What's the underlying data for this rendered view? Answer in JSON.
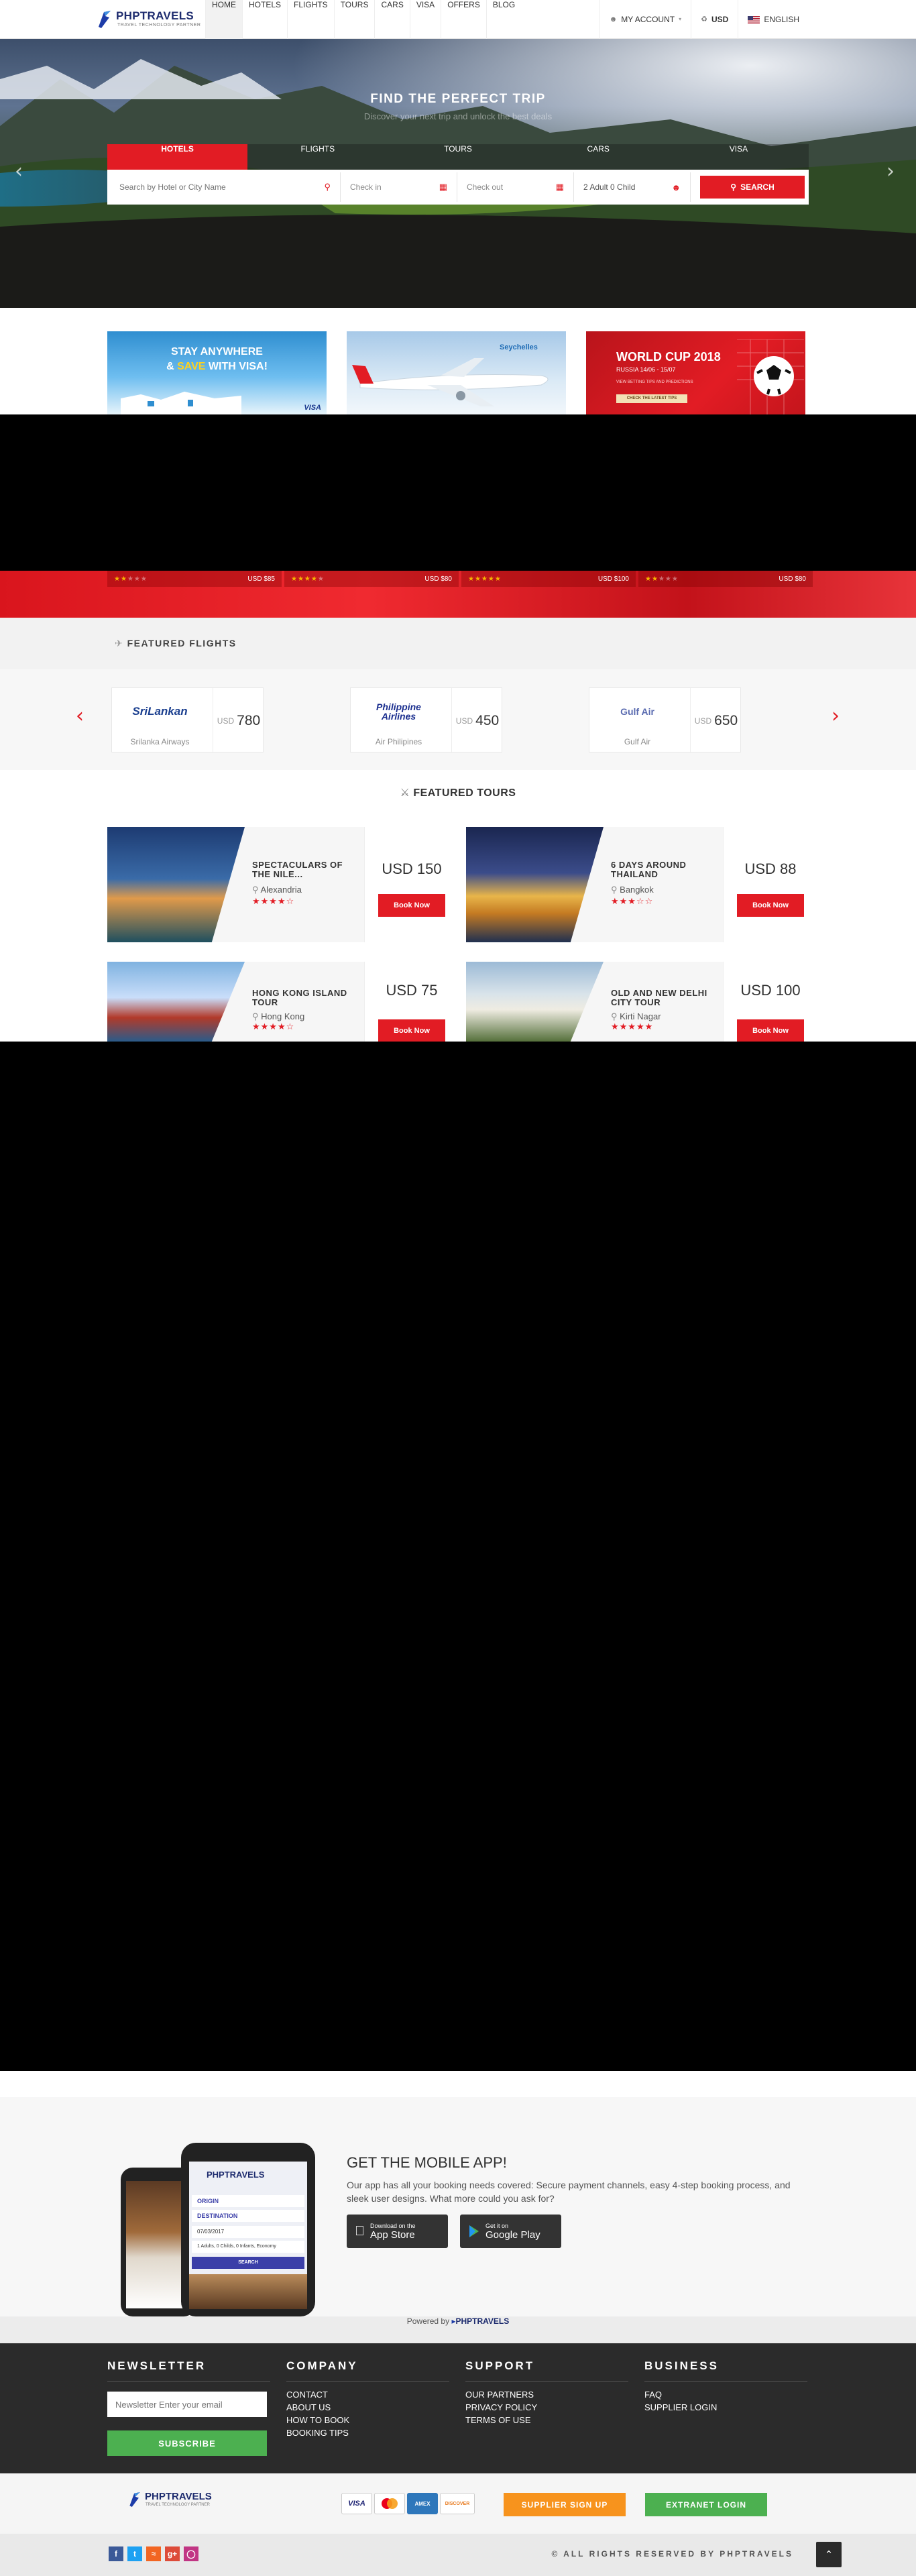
{
  "brand": {
    "name": "PHPTRAVELS",
    "tagline": "TRAVEL TECHNOLOGY PARTNER"
  },
  "nav": {
    "items": [
      "HOME",
      "HOTELS",
      "FLIGHTS",
      "TOURS",
      "CARS",
      "VISA",
      "OFFERS",
      "BLOG"
    ],
    "account": "MY ACCOUNT",
    "currency": "USD",
    "language": "ENGLISH"
  },
  "hero": {
    "title": "FIND THE PERFECT TRIP",
    "subtitle": "Discover your next trip and unlock the best deals",
    "tabs": [
      "HOTELS",
      "FLIGHTS",
      "TOURS",
      "CARS",
      "VISA"
    ],
    "search": {
      "placeholder": "Search by Hotel or City Name",
      "checkin": "Check in",
      "checkout": "Check out",
      "guests": "2 Adult 0 Child",
      "button": "SEARCH"
    }
  },
  "banners": {
    "visa_line1": "STAY ANYWHERE",
    "visa_line2_a": "& ",
    "visa_line2_b": "SAVE",
    "visa_line2_c": " WITH VISA!",
    "visa_brand": "VISA",
    "airline_brand": "Seychelles",
    "worldcup_title": "WORLD CUP 2018",
    "worldcup_dates": "RUSSIA 14/06 - 15/07",
    "worldcup_tagline": "VIEW BETTING TIPS AND PREDICTIONS",
    "worldcup_cta": "CHECK THE LATEST TIPS"
  },
  "strip_cards": [
    {
      "stars": 2,
      "price": "USD $85"
    },
    {
      "stars": 4,
      "price": "USD $80"
    },
    {
      "stars": 5,
      "price": "USD $100"
    },
    {
      "stars": 2,
      "price": "USD $80"
    }
  ],
  "featured_flights": {
    "heading": "FEATURED FLIGHTS",
    "items": [
      {
        "airline": "Srilanka Airways",
        "logo": "SriLankan",
        "currency": "USD",
        "price": "780"
      },
      {
        "airline": "Air Philipines",
        "logo": "Philippine Airlines",
        "currency": "USD",
        "price": "450"
      },
      {
        "airline": "Gulf Air",
        "logo": "Gulf Air",
        "currency": "USD",
        "price": "650"
      }
    ]
  },
  "featured_tours": {
    "heading": "FEATURED TOURS",
    "book_label": "Book Now",
    "items": [
      {
        "name": "SPECTACULARS OF THE NILE...",
        "location": "Alexandria",
        "stars": 4,
        "price": "USD 150"
      },
      {
        "name": "6 DAYS AROUND THAILAND",
        "location": "Bangkok",
        "stars": 3,
        "price": "USD 88"
      },
      {
        "name": "HONG KONG ISLAND TOUR",
        "location": "Hong Kong",
        "stars": 4,
        "price": "USD 75"
      },
      {
        "name": "OLD AND NEW DELHI CITY TOUR",
        "location": "Kirti Nagar",
        "stars": 5,
        "price": "USD 100"
      }
    ]
  },
  "mobile_app": {
    "title": "GET THE MOBILE APP!",
    "text": "Our app has all your booking needs covered: Secure payment channels, easy 4-step booking process, and sleek user designs. What more could you ask for?",
    "appstore_small": "Download on the",
    "appstore_big": "App Store",
    "play_small": "Get it on",
    "play_big": "Google Play",
    "phone": {
      "origin": "ORIGIN",
      "destination": "DESTINATION",
      "date": "07/03/2017",
      "adults": "1 Adults, 0 Childs, 0 Infants, Economy",
      "search": "SEARCH",
      "brand": "PHPTRAVELS"
    }
  },
  "powered": {
    "prefix": "Powered by",
    "brand": "PHPTRAVELS"
  },
  "footer": {
    "newsletter": {
      "heading": "NEWSLETTER",
      "placeholder": "Newsletter Enter your email",
      "button": "SUBSCRIBE"
    },
    "company": {
      "heading": "COMPANY",
      "links": [
        "CONTACT",
        "ABOUT US",
        "HOW TO BOOK",
        "BOOKING TIPS"
      ]
    },
    "support": {
      "heading": "SUPPORT",
      "links": [
        "OUR PARTNERS",
        "PRIVACY POLICY",
        "TERMS OF USE"
      ]
    },
    "business": {
      "heading": "BUSINESS",
      "links": [
        "FAQ",
        "SUPPLIER LOGIN"
      ]
    }
  },
  "payments": [
    "VISA",
    "MC",
    "AMEX",
    "DISCOVER"
  ],
  "supplier_btn": "SUPPLIER SIGN UP",
  "extranet_btn": "EXTRANET LOGIN",
  "copyright": "© ALL RIGHTS RESERVED BY PHPTRAVELS",
  "colors": {
    "accent": "#e21c24",
    "green": "#4cb050",
    "orange": "#f7931d",
    "dark": "#2b2b2b"
  }
}
